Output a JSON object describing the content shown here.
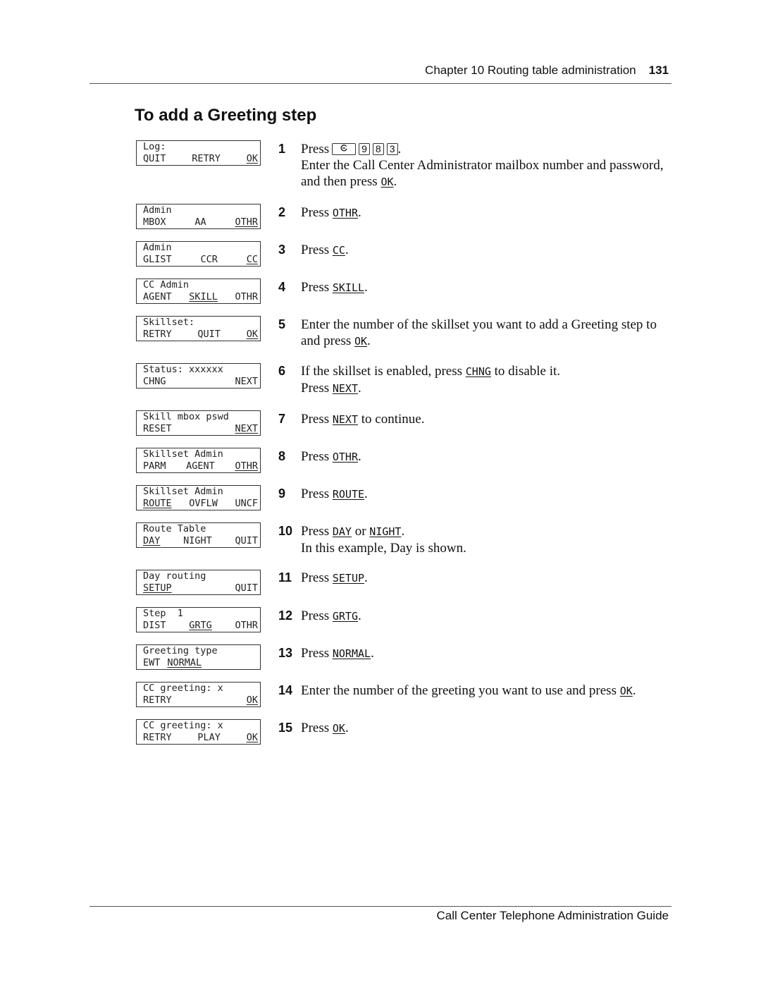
{
  "header": {
    "chapter": "Chapter 10  Routing table administration",
    "page_number": "131"
  },
  "title": "To add a Greeting step",
  "footer": "Call Center Telephone Administration Guide",
  "lcd_screens": [
    {
      "line1": "Log:",
      "softkeys": [
        {
          "label": "QUIT",
          "u": false
        },
        {
          "label": "RETRY",
          "u": false
        },
        {
          "label": "OK",
          "u": true
        }
      ]
    },
    {
      "line1": "Admin",
      "softkeys": [
        {
          "label": "MBOX",
          "u": false
        },
        {
          "label": "AA",
          "u": false
        },
        {
          "label": "OTHR",
          "u": true
        }
      ]
    },
    {
      "line1": "Admin",
      "softkeys": [
        {
          "label": "GLIST",
          "u": false
        },
        {
          "label": "CCR",
          "u": false
        },
        {
          "label": "CC",
          "u": true
        }
      ]
    },
    {
      "line1": "CC Admin",
      "softkeys": [
        {
          "label": "AGENT",
          "u": false
        },
        {
          "label": "SKILL",
          "u": true
        },
        {
          "label": "OTHR",
          "u": false
        }
      ]
    },
    {
      "line1": "Skillset:",
      "softkeys": [
        {
          "label": "RETRY",
          "u": false
        },
        {
          "label": "QUIT",
          "u": false
        },
        {
          "label": "OK",
          "u": true
        }
      ]
    },
    {
      "line1": "Status: xxxxxx",
      "softkeys": [
        {
          "label": "CHNG",
          "u": false
        },
        {
          "label": "NEXT",
          "u": false
        }
      ]
    },
    {
      "line1": "Skill mbox pswd",
      "softkeys": [
        {
          "label": "RESET",
          "u": false
        },
        {
          "label": "NEXT",
          "u": true
        }
      ]
    },
    {
      "line1": "Skillset Admin",
      "softkeys": [
        {
          "label": "PARM",
          "u": false
        },
        {
          "label": "AGENT",
          "u": false
        },
        {
          "label": "OTHR",
          "u": true
        }
      ]
    },
    {
      "line1": "Skillset Admin",
      "softkeys": [
        {
          "label": "ROUTE",
          "u": true
        },
        {
          "label": "OVFLW",
          "u": false
        },
        {
          "label": "UNCF",
          "u": false
        }
      ]
    },
    {
      "line1": "Route Table",
      "softkeys": [
        {
          "label": "DAY",
          "u": true
        },
        {
          "label": "NIGHT",
          "u": false
        },
        {
          "label": "QUIT",
          "u": false
        }
      ]
    },
    {
      "line1": "Day routing",
      "softkeys": [
        {
          "label": "SETUP",
          "u": true
        },
        {
          "label": "QUIT",
          "u": false
        }
      ]
    },
    {
      "line1": "Step  1",
      "softkeys": [
        {
          "label": "DIST",
          "u": false
        },
        {
          "label": "GRTG",
          "u": true
        },
        {
          "label": "OTHR",
          "u": false
        }
      ]
    },
    {
      "line1": "Greeting type",
      "softkeys": [
        {
          "label": "EWT",
          "u": false
        },
        {
          "label": "NORMAL",
          "u": true
        }
      ],
      "left_align": true
    },
    {
      "line1": "CC greeting: x",
      "softkeys": [
        {
          "label": "RETRY",
          "u": false
        },
        {
          "label": "OK",
          "u": true
        }
      ]
    },
    {
      "line1": "CC greeting: x",
      "softkeys": [
        {
          "label": "RETRY",
          "u": false
        },
        {
          "label": "PLAY",
          "u": false
        },
        {
          "label": "OK",
          "u": true
        }
      ]
    }
  ],
  "steps": [
    {
      "num": "1",
      "parts": [
        {
          "t": "Press"
        },
        {
          "key": "feature-icon"
        },
        {
          "key": "9"
        },
        {
          "key": "8"
        },
        {
          "key": "3"
        },
        {
          "t": "."
        },
        {
          "br": true
        },
        {
          "t": "Enter the Call Center Administrator mailbox number and password, and then press "
        },
        {
          "kw": "OK"
        },
        {
          "t": "."
        }
      ]
    },
    {
      "num": "2",
      "parts": [
        {
          "t": "Press "
        },
        {
          "kw": "OTHR"
        },
        {
          "t": "."
        }
      ]
    },
    {
      "num": "3",
      "parts": [
        {
          "t": "Press "
        },
        {
          "kw": "CC"
        },
        {
          "t": "."
        }
      ]
    },
    {
      "num": "4",
      "parts": [
        {
          "t": "Press "
        },
        {
          "kw": "SKILL"
        },
        {
          "t": "."
        }
      ]
    },
    {
      "num": "5",
      "parts": [
        {
          "t": "Enter the number of the skillset you want to add a Greeting step to and press "
        },
        {
          "kw": "OK"
        },
        {
          "t": "."
        }
      ]
    },
    {
      "num": "6",
      "parts": [
        {
          "t": "If the skillset is enabled, press "
        },
        {
          "kw": "CHNG"
        },
        {
          "t": " to disable it."
        },
        {
          "br": true
        },
        {
          "t": "Press "
        },
        {
          "kw": "NEXT"
        },
        {
          "t": "."
        }
      ]
    },
    {
      "num": "7",
      "parts": [
        {
          "t": "Press "
        },
        {
          "kw": "NEXT"
        },
        {
          "t": " to continue."
        }
      ]
    },
    {
      "num": "8",
      "parts": [
        {
          "t": "Press "
        },
        {
          "kw": "OTHR"
        },
        {
          "t": "."
        }
      ]
    },
    {
      "num": "9",
      "parts": [
        {
          "t": "Press "
        },
        {
          "kw": "ROUTE"
        },
        {
          "t": "."
        }
      ]
    },
    {
      "num": "10",
      "parts": [
        {
          "t": "Press "
        },
        {
          "kw": "DAY"
        },
        {
          "t": " or "
        },
        {
          "kw": "NIGHT"
        },
        {
          "t": "."
        },
        {
          "br": true
        },
        {
          "t": "In this example, Day is shown."
        }
      ]
    },
    {
      "num": "11",
      "parts": [
        {
          "t": "Press "
        },
        {
          "kw": "SETUP"
        },
        {
          "t": "."
        }
      ]
    },
    {
      "num": "12",
      "parts": [
        {
          "t": "Press "
        },
        {
          "kw": "GRTG"
        },
        {
          "t": "."
        }
      ]
    },
    {
      "num": "13",
      "parts": [
        {
          "t": "Press "
        },
        {
          "kw": "NORMAL"
        },
        {
          "t": "."
        }
      ]
    },
    {
      "num": "14",
      "parts": [
        {
          "t": "Enter the number of the greeting you want to use and press "
        },
        {
          "kw": "OK"
        },
        {
          "t": "."
        }
      ]
    },
    {
      "num": "15",
      "parts": [
        {
          "t": "Press "
        },
        {
          "kw": "OK"
        },
        {
          "t": "."
        }
      ]
    }
  ]
}
